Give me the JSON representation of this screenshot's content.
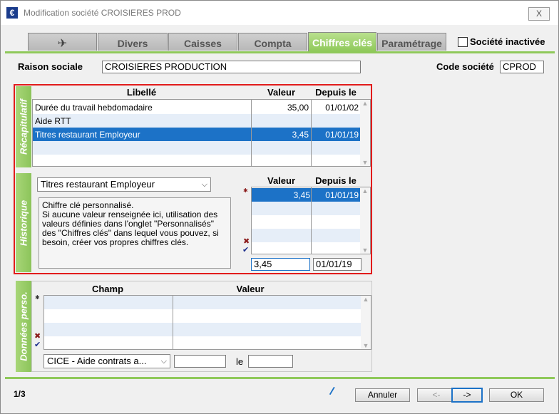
{
  "window": {
    "title": "Modification société CROISIERES PROD",
    "close": "X"
  },
  "tabs": [
    {
      "label": ""
    },
    {
      "label": "Divers"
    },
    {
      "label": "Caisses"
    },
    {
      "label": "Compta"
    },
    {
      "label": "Chiffres clés"
    },
    {
      "label": "Paramétrage"
    }
  ],
  "company": {
    "inactive_label": "Société inactivée",
    "raison_label": "Raison sociale",
    "raison_value": "CROISIERES PRODUCTION",
    "code_label": "Code société",
    "code_value": "CPROD"
  },
  "recap": {
    "section_label": "Récapitulatif",
    "columns": {
      "libelle": "Libellé",
      "valeur": "Valeur",
      "depuis": "Depuis le"
    },
    "rows": [
      {
        "libelle": "Durée du travail hebdomadaire",
        "valeur": "35,00",
        "depuis": "01/01/02"
      },
      {
        "libelle": "Aide RTT",
        "valeur": "",
        "depuis": ""
      },
      {
        "libelle": "Titres restaurant Employeur",
        "valeur": "3,45",
        "depuis": "01/01/19"
      }
    ]
  },
  "historique": {
    "section_label": "Historique",
    "select_value": "Titres restaurant Employeur",
    "note": "Chiffre clé personnalisé.\nSi aucune valeur renseignée ici, utilisation des valeurs définies dans l'onglet \"Personnalisés\" des \"Chiffres clés\" dans lequel vous pouvez, si besoin, créer vos propres chiffres clés.",
    "columns": {
      "valeur": "Valeur",
      "depuis": "Depuis le"
    },
    "rows": [
      {
        "valeur": "3,45",
        "depuis": "01/01/19"
      }
    ],
    "edit_valeur": "3,45",
    "edit_depuis": "01/01/19"
  },
  "perso": {
    "section_label": "Données perso.",
    "columns": {
      "champ": "Champ",
      "valeur": "Valeur"
    },
    "select_value": "CICE - Aide contrats a...",
    "le_label": "le"
  },
  "footer": {
    "page": "1/3",
    "annuler": "Annuler",
    "prev": "<-",
    "next": "->",
    "ok": "OK"
  },
  "colors": {
    "accent_green": "#8fc95a",
    "selection_blue": "#1c72c7",
    "highlight_red": "#e21b1b"
  }
}
